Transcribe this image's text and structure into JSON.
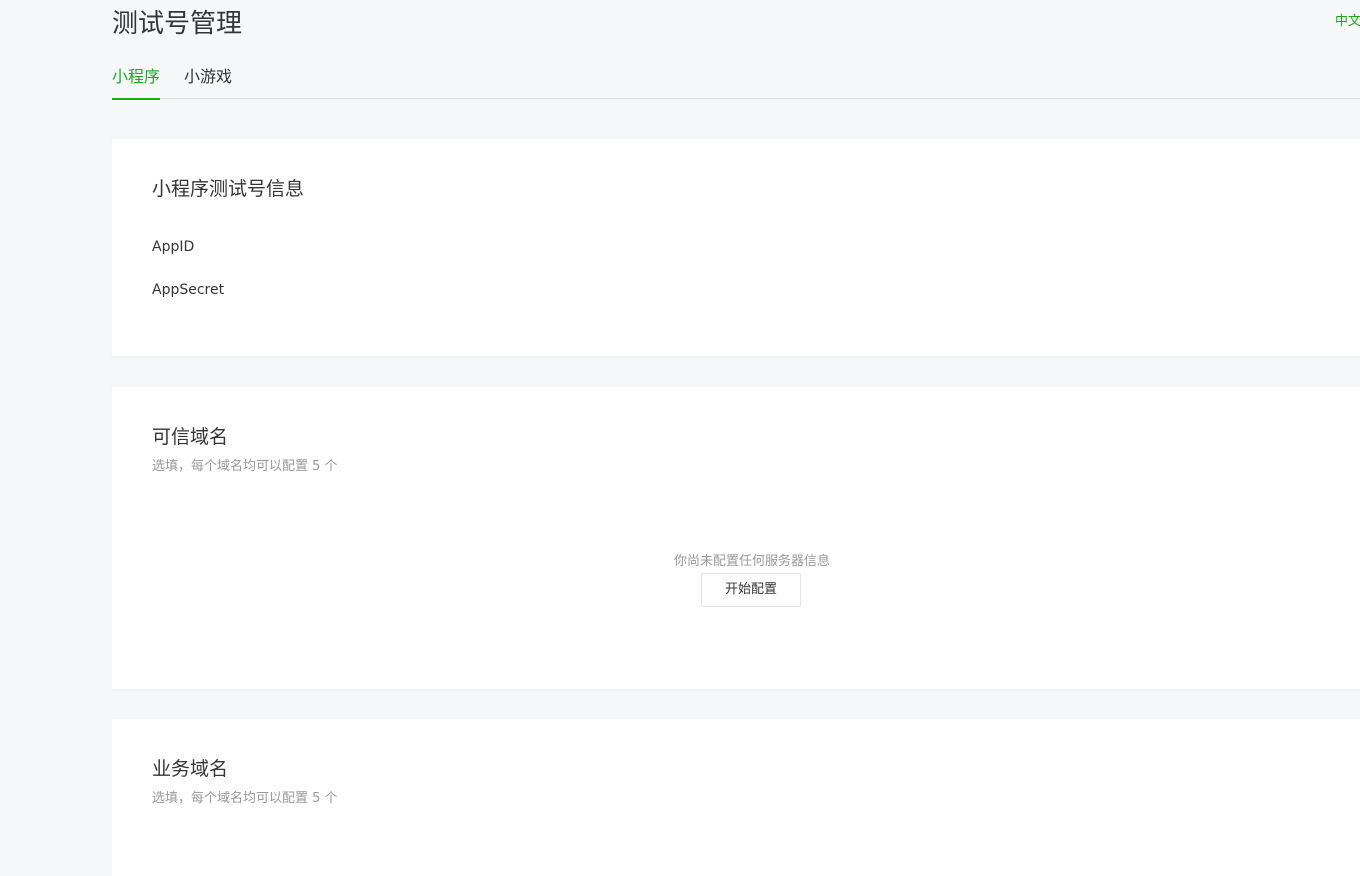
{
  "header": {
    "title": "测试号管理",
    "language_link": "中文"
  },
  "tabs": [
    {
      "label": "小程序",
      "active": true
    },
    {
      "label": "小游戏",
      "active": false
    }
  ],
  "account_info": {
    "title": "小程序测试号信息",
    "fields": [
      {
        "label": "AppID",
        "value": ""
      },
      {
        "label": "AppSecret",
        "value": ""
      }
    ]
  },
  "trusted_domains": {
    "title": "可信域名",
    "description": "选填，每个域名均可以配置 5 个",
    "empty_text": "你尚未配置任何服务器信息",
    "start_button_label": "开始配置"
  },
  "business_domains": {
    "title": "业务域名",
    "description": "选填，每个域名均可以配置 5 个"
  },
  "colors": {
    "accent": "#1aad19",
    "background": "#f6f7f9",
    "card": "#ffffff",
    "muted_text": "#9a9a9a"
  }
}
